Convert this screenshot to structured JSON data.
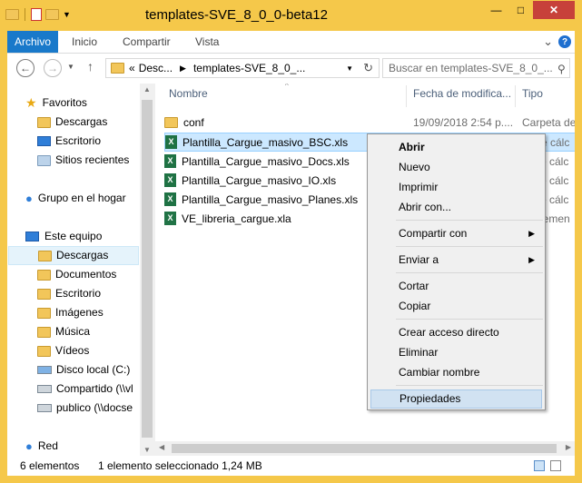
{
  "window": {
    "title": "templates-SVE_8_0_0-beta12",
    "minimize": "—",
    "maximize": "□",
    "close": "✕"
  },
  "ribbon": {
    "file": "Archivo",
    "tabs": [
      "Inicio",
      "Compartir",
      "Vista"
    ],
    "expand": "⌄",
    "help": "?"
  },
  "address": {
    "crumb_prefix": "«",
    "crumb1": "Desc...",
    "crumb2": "templates-SVE_8_0_...",
    "search_placeholder": "Buscar en templates-SVE_8_0_..."
  },
  "nav": {
    "favoritos": "Favoritos",
    "descargas_fav": "Descargas",
    "escritorio_fav": "Escritorio",
    "sitios": "Sitios recientes",
    "grupo": "Grupo en el hogar",
    "equipo": "Este equipo",
    "descargas": "Descargas",
    "documentos": "Documentos",
    "escritorio": "Escritorio",
    "imagenes": "Imágenes",
    "musica": "Música",
    "videos": "Vídeos",
    "disco": "Disco local (C:)",
    "compartido": "Compartido (\\\\vl",
    "publico": "publico (\\\\docse",
    "red": "Red"
  },
  "columns": {
    "name": "Nombre",
    "date": "Fecha de modifica...",
    "type": "Tipo"
  },
  "files": [
    {
      "name": "conf",
      "date": "19/09/2018 2:54 p....",
      "type": "Carpeta de a"
    },
    {
      "name": "Plantilla_Cargue_masivo_BSC.xls",
      "date": "",
      "type": "e cálc"
    },
    {
      "name": "Plantilla_Cargue_masivo_Docs.xls",
      "date": "",
      "type": "e cálc"
    },
    {
      "name": "Plantilla_Cargue_masivo_IO.xls",
      "date": "",
      "type": "e cálc"
    },
    {
      "name": "Plantilla_Cargue_masivo_Planes.xls",
      "date": "",
      "type": "e cálc"
    },
    {
      "name": "VE_libreria_cargue.xla",
      "date": "",
      "type": "lemen"
    }
  ],
  "menu": {
    "abrir": "Abrir",
    "nuevo": "Nuevo",
    "imprimir": "Imprimir",
    "abrir_con": "Abrir con...",
    "compartir_con": "Compartir con",
    "enviar_a": "Enviar a",
    "cortar": "Cortar",
    "copiar": "Copiar",
    "crear_acceso": "Crear acceso directo",
    "eliminar": "Eliminar",
    "cambiar_nombre": "Cambiar nombre",
    "propiedades": "Propiedades"
  },
  "status": {
    "count": "6 elementos",
    "selected": "1 elemento seleccionado  1,24 MB"
  }
}
